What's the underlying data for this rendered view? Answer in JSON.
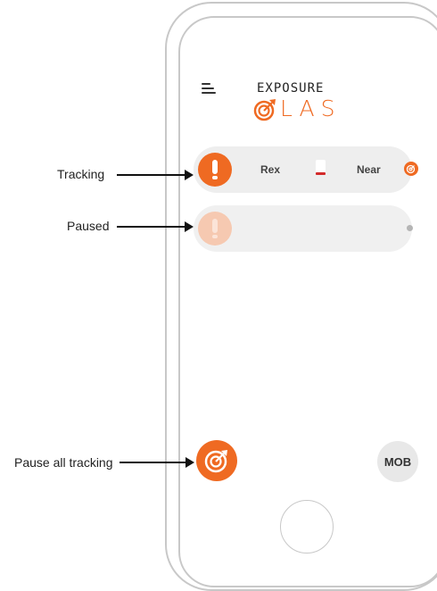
{
  "header": {
    "logo_top": "EXPOSURE",
    "logo_bottom": "LAS",
    "menu_icon": "hamburger-icon"
  },
  "rows": [
    {
      "status": "tracking",
      "name": "Rex",
      "distance": "Near",
      "battery_level": 0.2,
      "icon": "target-icon"
    },
    {
      "status": "paused",
      "name": "",
      "distance": ""
    }
  ],
  "annotations": {
    "tracking": "Tracking",
    "paused": "Paused",
    "pause_all": "Pause all tracking"
  },
  "bottom": {
    "pause_all_icon": "target-icon",
    "mob_label": "MOB"
  },
  "colors": {
    "accent": "#ef6a22",
    "battery_low": "#d22a2a",
    "row_bg": "#eeeeee"
  }
}
